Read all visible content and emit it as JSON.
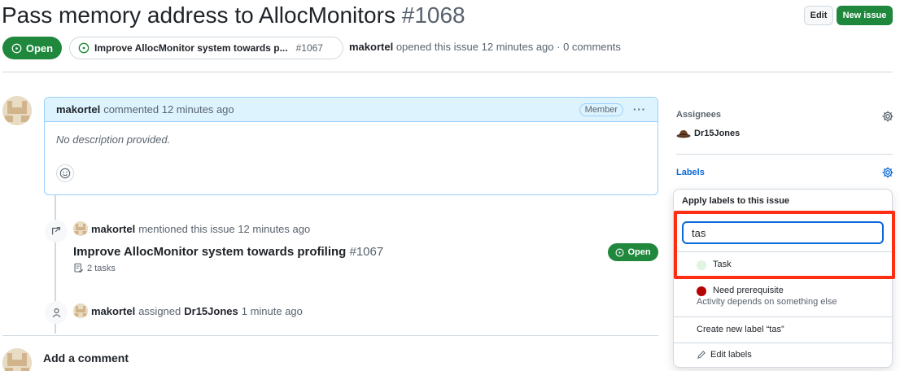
{
  "issue": {
    "title": "Pass memory address to AllocMonitors",
    "number": "#1068",
    "state": "Open",
    "meta_author": "makortel",
    "meta_text": "opened this issue 12 minutes ago · 0 comments"
  },
  "header": {
    "edit_label": "Edit",
    "new_issue_label": "New issue"
  },
  "parent_issue": {
    "title": "Improve AllocMonitor system towards p...",
    "number": "#1067"
  },
  "comment": {
    "author": "makortel",
    "action": "commented 12 minutes ago",
    "role": "Member",
    "more": "···",
    "body": "No description provided."
  },
  "events": {
    "mention": {
      "author": "makortel",
      "text": "mentioned this issue 12 minutes ago",
      "ref_title": "Improve AllocMonitor system towards profiling",
      "ref_number": "#1067",
      "tasks": "2 tasks",
      "state": "Open"
    },
    "assign": {
      "author": "makortel",
      "text_before": "assigned",
      "assignee": "Dr15Jones",
      "text_after": "1 minute ago"
    }
  },
  "add_comment": "Add a comment",
  "sidebar": {
    "assignees_label": "Assignees",
    "assignee": "Dr15Jones",
    "labels_label": "Labels"
  },
  "label_menu": {
    "heading": "Apply labels to this issue",
    "filter_value": "tas",
    "items": [
      {
        "name": "Task",
        "color": "#dff5e1",
        "description": ""
      },
      {
        "name": "Need prerequisite",
        "color": "#b60205",
        "description": "Activity depends on something else"
      }
    ],
    "create_label": "Create new label “tas”",
    "edit_labels": "Edit labels"
  },
  "colors": {
    "green": "#1f883d",
    "blue": "#0969da",
    "highlight": "#ff2d12"
  }
}
